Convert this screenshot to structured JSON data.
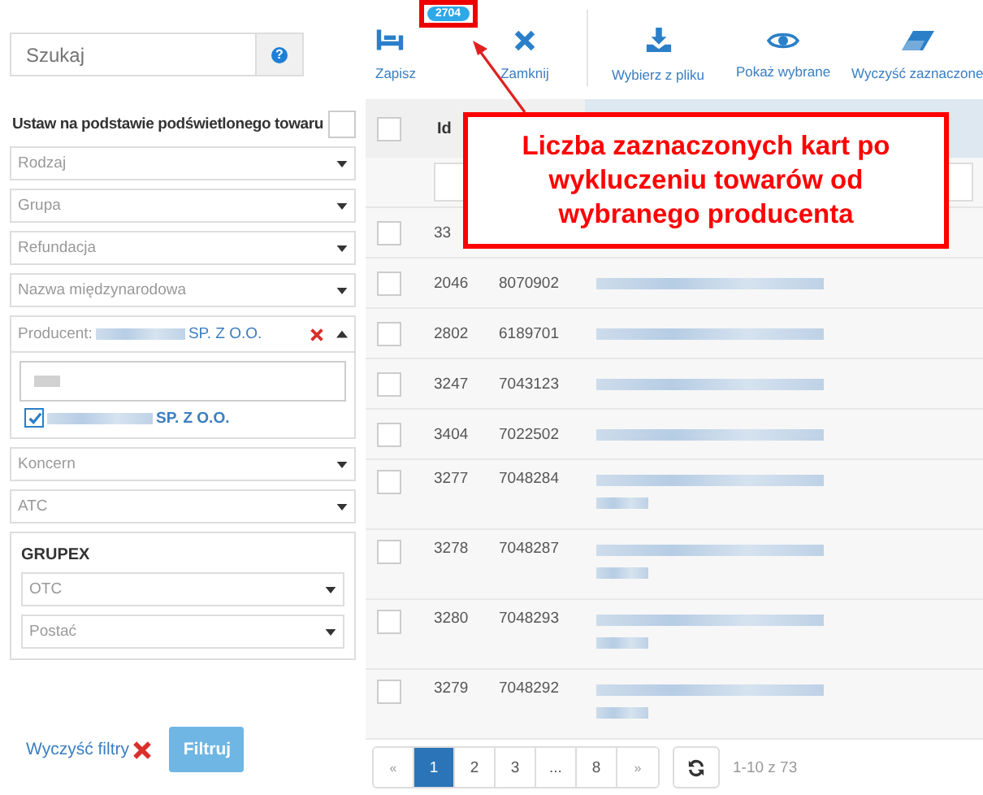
{
  "search": {
    "placeholder": "Szukaj",
    "help_icon": "?"
  },
  "highlight_option": {
    "label": "Ustaw na podstawie podświetlonego towaru",
    "checked": false
  },
  "filters": [
    {
      "kind": "select",
      "placeholder": "Rodzaj"
    },
    {
      "kind": "select",
      "placeholder": "Grupa"
    },
    {
      "kind": "select",
      "placeholder": "Refundacja"
    },
    {
      "kind": "select",
      "placeholder": "Nazwa międzynarodowa"
    },
    {
      "kind": "expanded",
      "label": "Producent:",
      "value_suffix": "SP. Z O.O.",
      "options": [
        {
          "suffix": "SP. Z O.O.",
          "checked": true
        }
      ]
    },
    {
      "kind": "select",
      "placeholder": "Koncern"
    },
    {
      "kind": "select",
      "placeholder": "ATC"
    }
  ],
  "group": {
    "title": "GRUPEX",
    "filters": [
      {
        "placeholder": "OTC"
      },
      {
        "placeholder": "Postać"
      }
    ]
  },
  "clear_filters": "Wyczyść filtry",
  "filter_button": "Filtruj",
  "toolbar": [
    {
      "kind": "save",
      "label": "Zapisz",
      "badge": "2704"
    },
    {
      "kind": "close",
      "label": "Zamknij"
    },
    {
      "kind": "import",
      "label": "Wybierz z pliku"
    },
    {
      "kind": "view",
      "label": "Pokaż wybrane"
    },
    {
      "kind": "erase",
      "label": "Wyczyść zaznaczone"
    }
  ],
  "table": {
    "columns": [
      "Id"
    ],
    "all_checked": false,
    "rows": [
      {
        "id": "33",
        "checked": false,
        "tall": false
      },
      {
        "id": "2046",
        "code": "8070902",
        "checked": false,
        "tall": false
      },
      {
        "id": "2802",
        "code": "6189701",
        "checked": false,
        "tall": false
      },
      {
        "id": "3247",
        "code": "7043123",
        "checked": false,
        "tall": false
      },
      {
        "id": "3404",
        "code": "7022502",
        "checked": false,
        "tall": false
      },
      {
        "id": "3277",
        "code": "7048284",
        "checked": false,
        "tall": true
      },
      {
        "id": "3278",
        "code": "7048287",
        "checked": false,
        "tall": true
      },
      {
        "id": "3280",
        "code": "7048293",
        "checked": false,
        "tall": true
      },
      {
        "id": "3279",
        "code": "7048292",
        "checked": false,
        "tall": true
      }
    ]
  },
  "pagination": {
    "prev": "«",
    "pages": [
      {
        "label": "1",
        "selected": true
      },
      {
        "label": "2",
        "selected": false
      },
      {
        "label": "3",
        "selected": false
      },
      {
        "label": "...",
        "selected": false
      },
      {
        "label": "8",
        "selected": false
      }
    ],
    "next": "»",
    "summary": "1-10 z 73"
  },
  "callout": "Liczba zaznaczonych kart po wykluczeniu towarów od wybranego producenta"
}
